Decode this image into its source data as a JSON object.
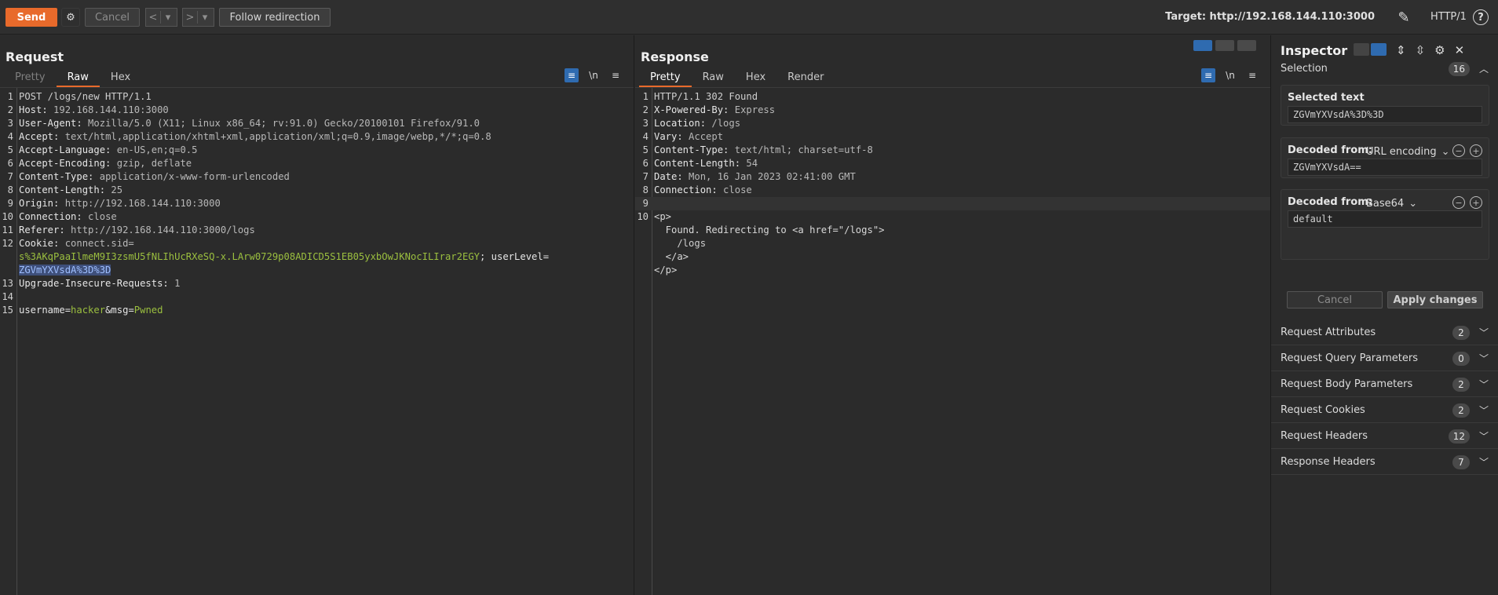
{
  "toolbar": {
    "send": "Send",
    "cancel": "Cancel",
    "prev": "<",
    "next": ">",
    "dropdown": "▾",
    "follow": "Follow redirection",
    "target": "Target: http://192.168.144.110:3000",
    "protocol": "HTTP/1",
    "help": "?"
  },
  "request": {
    "title": "Request",
    "tabs": [
      "Pretty",
      "Raw",
      "Hex"
    ],
    "lines": [
      {
        "n": "1",
        "text": "POST /logs/new HTTP/1.1"
      },
      {
        "n": "2",
        "key": "Host:",
        "val": " 192.168.144.110:3000"
      },
      {
        "n": "3",
        "key": "User-Agent:",
        "val": " Mozilla/5.0 (X11; Linux x86_64; rv:91.0) Gecko/20100101 Firefox/91.0"
      },
      {
        "n": "4",
        "key": "Accept:",
        "val": " text/html,application/xhtml+xml,application/xml;q=0.9,image/webp,*/*;q=0.8"
      },
      {
        "n": "5",
        "key": "Accept-Language:",
        "val": " en-US,en;q=0.5"
      },
      {
        "n": "6",
        "key": "Accept-Encoding:",
        "val": " gzip, deflate"
      },
      {
        "n": "7",
        "key": "Content-Type:",
        "val": " application/x-www-form-urlencoded"
      },
      {
        "n": "8",
        "key": "Content-Length:",
        "val": " 25"
      },
      {
        "n": "9",
        "key": "Origin:",
        "val": " http://192.168.144.110:3000"
      },
      {
        "n": "10",
        "key": "Connection:",
        "val": " close"
      },
      {
        "n": "11",
        "key": "Referer:",
        "val": " http://192.168.144.110:3000/logs"
      },
      {
        "n": "12",
        "key": "Cookie:",
        "val": " connect.sid="
      },
      {
        "n": "",
        "cookie_value": "s%3AKqPaaIlmeM9I3zsmU5fNLIhUcRXeSQ-x.LArw0729p08ADICD5S1EB05yxbOwJKNocILIrar2EGY",
        "after": "; userLevel="
      },
      {
        "n": "",
        "selected": "ZGVmYXVsdA%3D%3D"
      },
      {
        "n": "13",
        "key": "Upgrade-Insecure-Requests:",
        "val": " 1"
      },
      {
        "n": "14",
        "text": ""
      },
      {
        "n": "15",
        "param1": "username",
        "eq1": "=",
        "value1": "hacker",
        "amp": "&",
        "param2": "msg",
        "eq2": "=",
        "value2": "Pwned"
      }
    ]
  },
  "response": {
    "title": "Response",
    "tabs": [
      "Pretty",
      "Raw",
      "Hex",
      "Render"
    ],
    "lines": [
      {
        "n": "1",
        "text": "HTTP/1.1 302 Found"
      },
      {
        "n": "2",
        "key": "X-Powered-By:",
        "val": " Express"
      },
      {
        "n": "3",
        "key": "Location:",
        "val": " /logs"
      },
      {
        "n": "4",
        "key": "Vary:",
        "val": " Accept"
      },
      {
        "n": "5",
        "key": "Content-Type:",
        "val": " text/html; charset=utf-8"
      },
      {
        "n": "6",
        "key": "Content-Length:",
        "val": " 54"
      },
      {
        "n": "7",
        "key": "Date:",
        "val": " Mon, 16 Jan 2023 02:41:00 GMT"
      },
      {
        "n": "8",
        "key": "Connection:",
        "val": " close"
      },
      {
        "n": "9",
        "text": ""
      },
      {
        "n": "10",
        "text": "<p>"
      },
      {
        "n": "",
        "text": "  Found. Redirecting to <a href=\"/logs\">"
      },
      {
        "n": "",
        "text": "    /logs"
      },
      {
        "n": "",
        "text": "  </a>"
      },
      {
        "n": "",
        "text": "</p>"
      }
    ]
  },
  "inspector": {
    "title": "Inspector",
    "selection": {
      "label": "Selection",
      "count": "16"
    },
    "selected_text": {
      "label": "Selected text",
      "value": "ZGVmYXVsdA%3D%3D"
    },
    "decoded1": {
      "label": "Decoded from:",
      "encoding": "URL encoding",
      "value": "ZGVmYXVsdA=="
    },
    "decoded2": {
      "label": "Decoded from:",
      "encoding": "Base64",
      "value": "default"
    },
    "cancel": "Cancel",
    "apply": "Apply changes",
    "sections": [
      {
        "label": "Request Attributes",
        "count": "2"
      },
      {
        "label": "Request Query Parameters",
        "count": "0"
      },
      {
        "label": "Request Body Parameters",
        "count": "2"
      },
      {
        "label": "Request Cookies",
        "count": "2"
      },
      {
        "label": "Request Headers",
        "count": "12"
      },
      {
        "label": "Response Headers",
        "count": "7"
      }
    ]
  }
}
